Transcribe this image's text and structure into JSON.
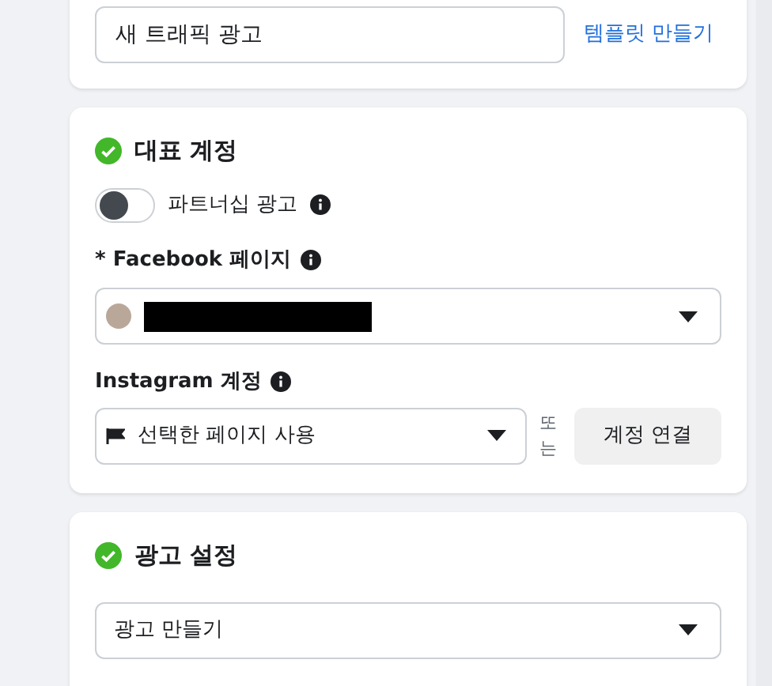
{
  "name_card": {
    "name_field": {
      "value": "새 트래픽 광고"
    },
    "template_link": "템플릿 만들기"
  },
  "identity": {
    "title": "대표 계정",
    "complete": true,
    "partnership": {
      "label": "파트너십 광고",
      "on": false
    },
    "facebook_page": {
      "required_mark": "*",
      "label": "Facebook 페이지"
    },
    "instagram": {
      "label": "Instagram 계정",
      "select": {
        "value": "선택한 페이지 사용"
      },
      "or_text": "또는",
      "connect_button": "계정 연결"
    }
  },
  "ad_setup": {
    "title": "광고 설정",
    "complete": true,
    "select": {
      "value": "광고 만들기"
    }
  }
}
